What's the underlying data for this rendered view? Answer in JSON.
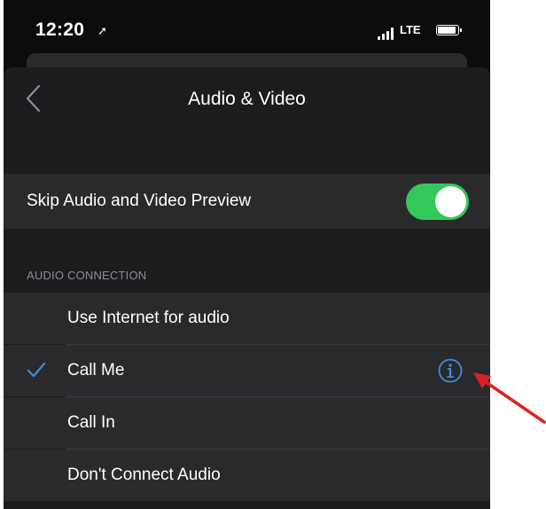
{
  "status_bar": {
    "time": "12:20",
    "location_icon": "location-arrow-icon",
    "network": "LTE"
  },
  "nav": {
    "title": "Audio & Video",
    "back_icon": "chevron-left-icon"
  },
  "settings": {
    "skip_preview": {
      "label": "Skip Audio and Video Preview",
      "enabled": true
    }
  },
  "audio_connection": {
    "header": "AUDIO CONNECTION",
    "options": [
      {
        "label": "Use Internet for audio",
        "selected": false
      },
      {
        "label": "Call Me",
        "selected": true,
        "has_info": true
      },
      {
        "label": "Call In",
        "selected": false
      },
      {
        "label": "Don't Connect Audio",
        "selected": false
      }
    ]
  },
  "colors": {
    "background": "#1c1c1e",
    "row_background": "#2a2a2d",
    "toggle_on": "#34c759",
    "accent_blue": "#3a8ee6",
    "annotation_red": "#e02020"
  }
}
